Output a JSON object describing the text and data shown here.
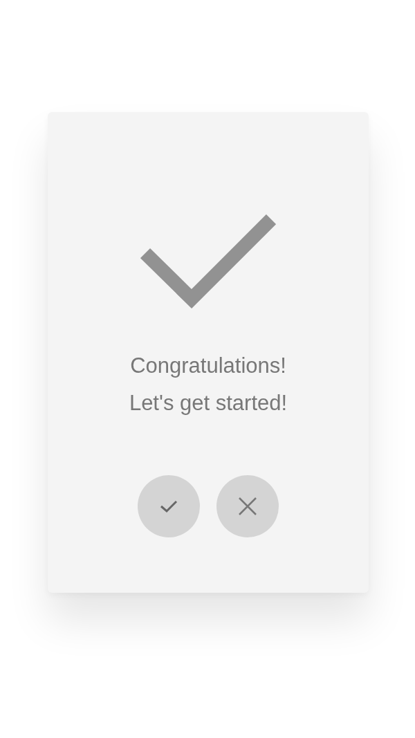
{
  "message": [
    "Congratulations!",
    "Let's get started!"
  ],
  "buttons": [
    {
      "kind": "confirm"
    },
    {
      "kind": "cancel"
    }
  ]
}
